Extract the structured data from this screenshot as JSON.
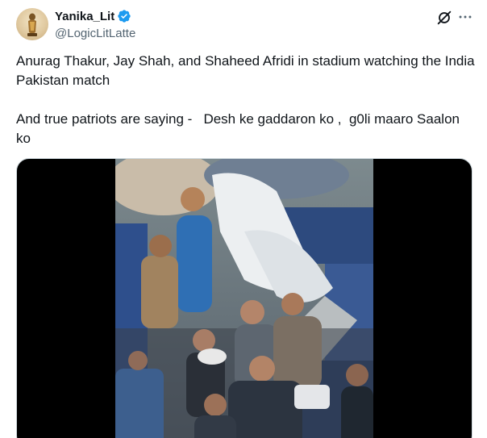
{
  "author": {
    "display_name": "Yanika_Lit",
    "handle": "@LogicLitLatte",
    "verified": true
  },
  "icons": {
    "avatar": "avatar-statuette",
    "verified": "verified-badge-icon",
    "grok": "grok-icon",
    "more": "more-icon"
  },
  "tweet": {
    "line1": "Anurag Thakur, Jay Shah, and Shaheed Afridi in stadium watching the India Pakistan match",
    "line2": "And true patriots are saying -   Desh ke gaddaron ko ,  g0li maaro Saalon ko"
  },
  "colors": {
    "verified": "#1d9bf0",
    "text": "#0f1419",
    "muted": "#536471"
  }
}
